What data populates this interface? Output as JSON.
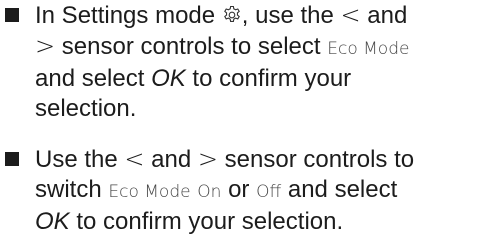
{
  "steps": [
    {
      "t1": "In Settings mode ",
      "t2": ", use the ",
      "lt": "<",
      "t3": " and",
      "gt": ">",
      "t4": " sensor controls to select ",
      "display": "Eco Mode",
      "t5": "and select ",
      "ok": "OK",
      "t6": " to confirm your",
      "t7": "selection.",
      "icon": "gear-icon"
    },
    {
      "t1": "Use the ",
      "lt": "<",
      "t2": " and ",
      "gt": ">",
      "t3": " sensor controls to",
      "t4": "switch ",
      "display_mode": "Eco Mode",
      "display_on": "On",
      "t5": " or ",
      "display_off": "Off",
      "t6": " and select",
      "ok": "OK",
      "t7": " to confirm your selection."
    }
  ]
}
